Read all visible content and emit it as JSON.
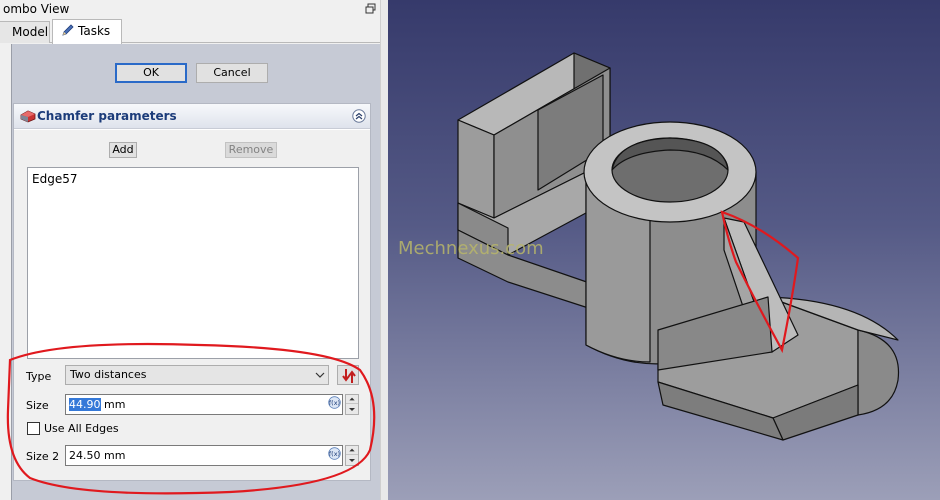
{
  "window": {
    "title": "ombo View"
  },
  "tabs": [
    {
      "label": "Model",
      "active": false
    },
    {
      "label": "Tasks",
      "active": true
    }
  ],
  "dialog": {
    "ok_label": "OK",
    "cancel_label": "Cancel"
  },
  "panel": {
    "title": "Chamfer parameters",
    "add_label": "Add",
    "remove_label": "Remove",
    "edges": [
      "Edge57"
    ],
    "type_label": "Type",
    "type_value": "Two distances",
    "size_label": "Size",
    "size_value": "44.90",
    "size_unit": " mm",
    "use_all_label": "Use All Edges",
    "use_all_checked": false,
    "size2_label": "Size 2",
    "size2_value": "24.50 mm"
  },
  "viewport": {
    "watermark": "Mechnexus.com"
  },
  "colors": {
    "accent": "#2a6ac8",
    "annotation": "#e0191e",
    "panel_bg": "#c6cad5"
  }
}
